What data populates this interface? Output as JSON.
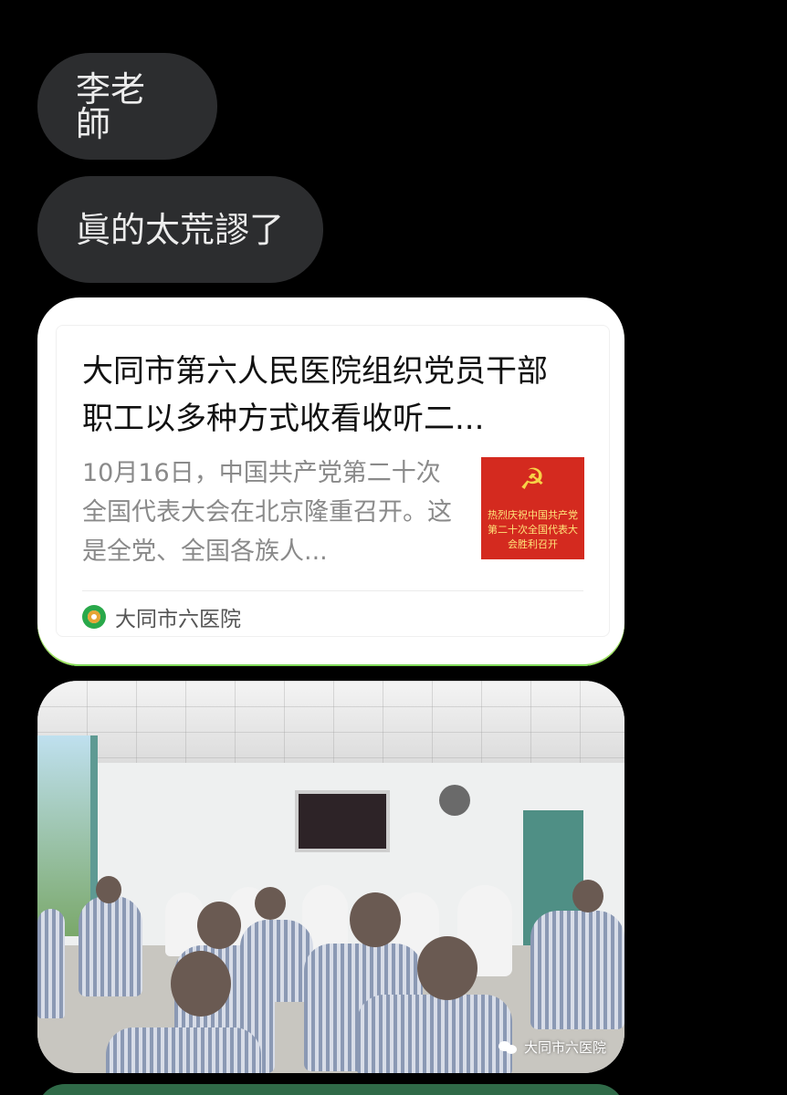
{
  "messages": [
    {
      "text": "李老師"
    },
    {
      "text": "眞的太荒謬了"
    }
  ],
  "link_card": {
    "title": "大同市第六人民医院组织党员干部职工以多种方式收看收听二...",
    "description": "10月16日，中国共产党第二十次全国代表大会在北京隆重召开。这是全党、全国各族人...",
    "thumbnail_text": "热烈庆祝中国共产党第二十次全国代表大会胜利召开",
    "source": "大同市六医院"
  },
  "photo": {
    "watermark": "大同市六医院"
  },
  "colors": {
    "bubble_bg": "#2c2d2f",
    "card_accent": "#7ed957",
    "thumb_red": "#d42a1f"
  }
}
